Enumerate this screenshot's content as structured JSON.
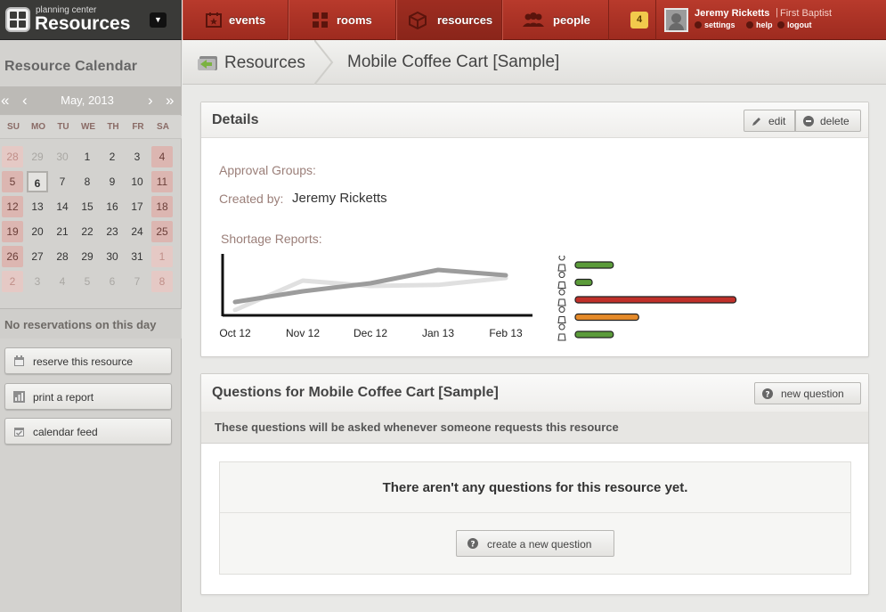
{
  "app": {
    "brand_small": "planning center",
    "brand_big": "Resources"
  },
  "sidebar": {
    "calendar_title": "Resource Calendar",
    "nav_prev_year": "«",
    "nav_prev": "‹",
    "month_label": "May, 2013",
    "nav_next": "›",
    "nav_next_year": "»",
    "weekdays": [
      "SU",
      "MO",
      "TU",
      "WE",
      "TH",
      "FR",
      "SA"
    ],
    "days": [
      [
        "28",
        "29",
        "30",
        "1",
        "2",
        "3",
        "4"
      ],
      [
        "5",
        "6",
        "7",
        "8",
        "9",
        "10",
        "11"
      ],
      [
        "12",
        "13",
        "14",
        "15",
        "16",
        "17",
        "18"
      ],
      [
        "19",
        "20",
        "21",
        "22",
        "23",
        "24",
        "25"
      ],
      [
        "26",
        "27",
        "28",
        "29",
        "30",
        "31",
        "1"
      ],
      [
        "2",
        "3",
        "4",
        "5",
        "6",
        "7",
        "8"
      ]
    ],
    "no_reservations": "No reservations on this day",
    "actions": [
      {
        "label": "reserve this resource",
        "icon": "calendar-icon"
      },
      {
        "label": "print a report",
        "icon": "bar-chart-icon"
      },
      {
        "label": "calendar feed",
        "icon": "calendar-check-icon"
      }
    ]
  },
  "topnav": {
    "tabs": [
      {
        "label": "events",
        "icon": "event-icon"
      },
      {
        "label": "rooms",
        "icon": "grid-icon"
      },
      {
        "label": "resources",
        "icon": "box-icon",
        "active": true
      },
      {
        "label": "people",
        "icon": "people-icon"
      }
    ],
    "notification_count": "4",
    "user_name": "Jeremy Ricketts",
    "separator": "|",
    "org": "First Baptist",
    "links": [
      "settings",
      "help",
      "logout"
    ]
  },
  "breadcrumb": {
    "section": "Resources",
    "page": "Mobile Coffee Cart [Sample]"
  },
  "details": {
    "title": "Details",
    "edit_label": "edit",
    "delete_label": "delete",
    "approval_groups_label": "Approval Groups:",
    "created_by_label": "Created by:",
    "created_by_value": "Jeremy Ricketts",
    "shortage_label": "Shortage Reports:"
  },
  "chart_data": {
    "type": "line",
    "x": [
      "Oct 12",
      "Nov 12",
      "Dec 12",
      "Jan 13",
      "Feb 13"
    ],
    "series": [
      {
        "values": [
          2,
          4,
          5.5,
          8,
          7
        ],
        "color": "#9c9c9c"
      },
      {
        "values": [
          0.5,
          6,
          5,
          5.2,
          6.5
        ],
        "color": "#e0e0e0"
      }
    ],
    "ylim": [
      0,
      10
    ],
    "bar_values": [
      45,
      20,
      190,
      75,
      45
    ],
    "bar_colors": [
      "#5b9b3a",
      "#5b9b3a",
      "#c0302a",
      "#e58a2a",
      "#5b9b3a"
    ]
  },
  "questions": {
    "title": "Questions for Mobile Coffee Cart [Sample]",
    "new_question_label": "new question",
    "banner": "These questions will be asked whenever someone requests this resource",
    "empty_text": "There aren't any questions for this resource yet.",
    "create_label": "create a new question"
  }
}
